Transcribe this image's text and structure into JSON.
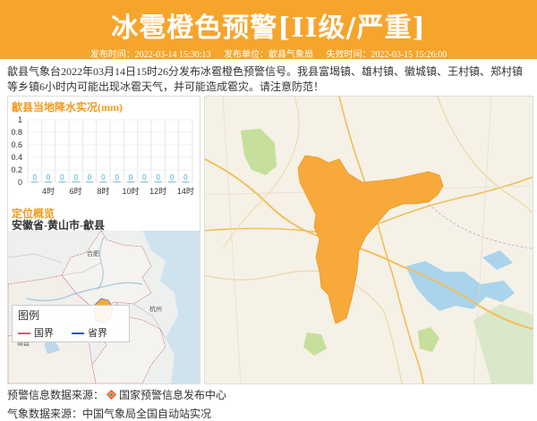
{
  "header": {
    "title": "冰雹橙色预警[II级/严重]",
    "issue_time": "发布时间：2022-03-14 15:30:13",
    "issuer": "发布单位：歙县气象局",
    "expire_time": "失效时间：2022-03-15 15:26:00"
  },
  "description": "歙县气象台2022年03月14日15时26分发布冰雹橙色预警信号。我县富堨镇、雄村镇、徽城镇、王村镇、郑村镇等乡镇6小时内可能出现冰雹天气，并可能造成雹灾。请注意防范！",
  "precip_panel": {
    "title": "歙县当地降水实况(mm)"
  },
  "chart_data": {
    "type": "line",
    "title": "歙县当地降水实况(mm)",
    "ylabel": "mm",
    "ylim": [
      0,
      1
    ],
    "y_ticks": [
      "1",
      "0.8",
      "0.6",
      "0.4",
      "0.2",
      "0"
    ],
    "x": [
      "3时",
      "4时",
      "5时",
      "6时",
      "7时",
      "8时",
      "9时",
      "10时",
      "11时",
      "12时",
      "13时",
      "14时"
    ],
    "x_tick_labels": [
      "4时",
      "6时",
      "8时",
      "10时",
      "12时",
      "14时"
    ],
    "series": [
      {
        "values": [
          0,
          0,
          0,
          0,
          0,
          0,
          0,
          0,
          0,
          0,
          0,
          0
        ],
        "data_labels": [
          "0",
          "0",
          "0",
          "0",
          "0",
          "0",
          "0",
          "0",
          "0",
          "0",
          "0",
          "0"
        ]
      }
    ],
    "colors": {
      "bar": "#6ec1e4",
      "grid": "#e6e6e6"
    }
  },
  "location": {
    "title": "定位概览",
    "name": "安徽省-黄山市-歙县"
  },
  "minimap_labels": {
    "hefei": "合肥",
    "hangzhou": "杭州",
    "nanchang": "南昌"
  },
  "legend": {
    "title": "图例",
    "national": "国界",
    "provincial": "省界",
    "national_color": "#c7607c",
    "provincial_color": "#2f57c2"
  },
  "footer": {
    "warning_source": "预警信息数据来源：",
    "warning_source_name": "国家预警信息发布中心",
    "weather_source": "气象数据来源：中国气象局全国自动站实况"
  },
  "colors": {
    "header_bg": "#f6a52c",
    "warning_area": "#f7a93a",
    "accent_text": "#f39a1d"
  },
  "icons": [
    "warning-center-logo-icon"
  ]
}
